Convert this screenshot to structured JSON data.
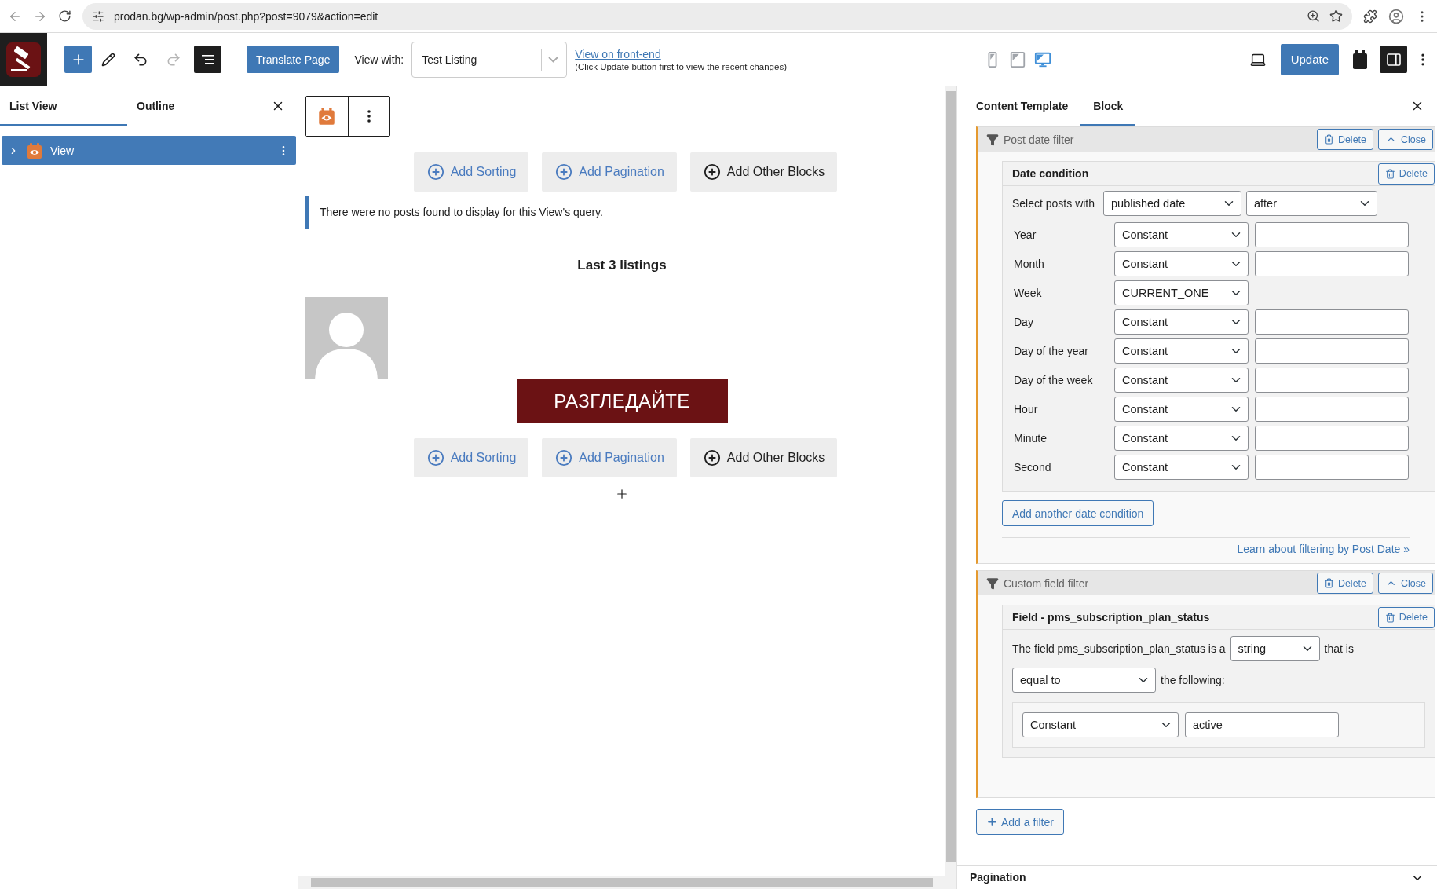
{
  "browser": {
    "url": "prodan.bg/wp-admin/post.php?post=9079&action=edit"
  },
  "toolbar": {
    "translate_button": "Translate Page",
    "view_with_label": "View with:",
    "view_with_value": "Test Listing",
    "front_end_link": "View on front-end",
    "front_end_note": "(Click Update button first to view the recent changes)",
    "devices": [
      {
        "kind": "mobile",
        "selected": false
      },
      {
        "kind": "tablet",
        "selected": false
      },
      {
        "kind": "desktop",
        "selected": true
      }
    ],
    "update_button": "Update"
  },
  "list_panel": {
    "tabs": [
      {
        "label": "List View",
        "selected": true
      },
      {
        "label": "Outline",
        "selected": false
      }
    ],
    "items": [
      {
        "label": "View",
        "selected": true
      }
    ]
  },
  "canvas": {
    "blocks": [
      {
        "kind": "actions",
        "buttons": [
          {
            "label": "Add Sorting",
            "kind": "accent"
          },
          {
            "label": "Add Pagination",
            "kind": "accent"
          },
          {
            "label": "Add Other Blocks",
            "kind": "plain"
          }
        ]
      },
      {
        "kind": "notice",
        "text": "There were no posts found to display for this View's query."
      },
      {
        "kind": "heading",
        "text": "Last 3 listings"
      },
      {
        "kind": "avatar"
      },
      {
        "kind": "cta",
        "text": "РАЗГЛЕДАЙТЕ"
      },
      {
        "kind": "actions",
        "buttons": [
          {
            "label": "Add Sorting",
            "kind": "accent"
          },
          {
            "label": "Add Pagination",
            "kind": "accent"
          },
          {
            "label": "Add Other Blocks",
            "kind": "plain"
          }
        ]
      },
      {
        "kind": "inserter"
      }
    ]
  },
  "settings_panel": {
    "tabs": [
      {
        "label": "Content Template",
        "selected": false
      },
      {
        "label": "Block",
        "selected": true
      }
    ],
    "filters": [
      {
        "kind": "date",
        "title": "Post date filter",
        "delete_label": "Delete",
        "close_label": "Close",
        "condition": {
          "title": "Date condition",
          "delete_label": "Delete",
          "select_label": "Select posts with",
          "select_value": "published date",
          "compare_value": "after",
          "rows": [
            {
              "label": "Year",
              "mode": "Constant",
              "has_input": true
            },
            {
              "label": "Month",
              "mode": "Constant",
              "has_input": true
            },
            {
              "label": "Week",
              "mode": "CURRENT_ONE",
              "has_input": false
            },
            {
              "label": "Day",
              "mode": "Constant",
              "has_input": true
            },
            {
              "label": "Day of the year",
              "mode": "Constant",
              "has_input": true
            },
            {
              "label": "Day of the week",
              "mode": "Constant",
              "has_input": true
            },
            {
              "label": "Hour",
              "mode": "Constant",
              "has_input": true
            },
            {
              "label": "Minute",
              "mode": "Constant",
              "has_input": true
            },
            {
              "label": "Second",
              "mode": "Constant",
              "has_input": true
            }
          ]
        },
        "add_button": "Add another date condition",
        "learn_link": "Learn about filtering by Post Date »"
      },
      {
        "kind": "field",
        "title": "Custom field filter",
        "delete_label": "Delete",
        "close_label": "Close",
        "condition": {
          "title": "Field - pms_subscription_plan_status",
          "delete_label": "Delete",
          "text_before": "The field pms_subscription_plan_status is a",
          "type_value": "string",
          "text_after": "that is",
          "compare_value": "equal to",
          "text_following": "the following:",
          "mode": "Constant",
          "value": "active"
        }
      }
    ],
    "add_filter": "Add a filter",
    "next_section": "Pagination"
  }
}
